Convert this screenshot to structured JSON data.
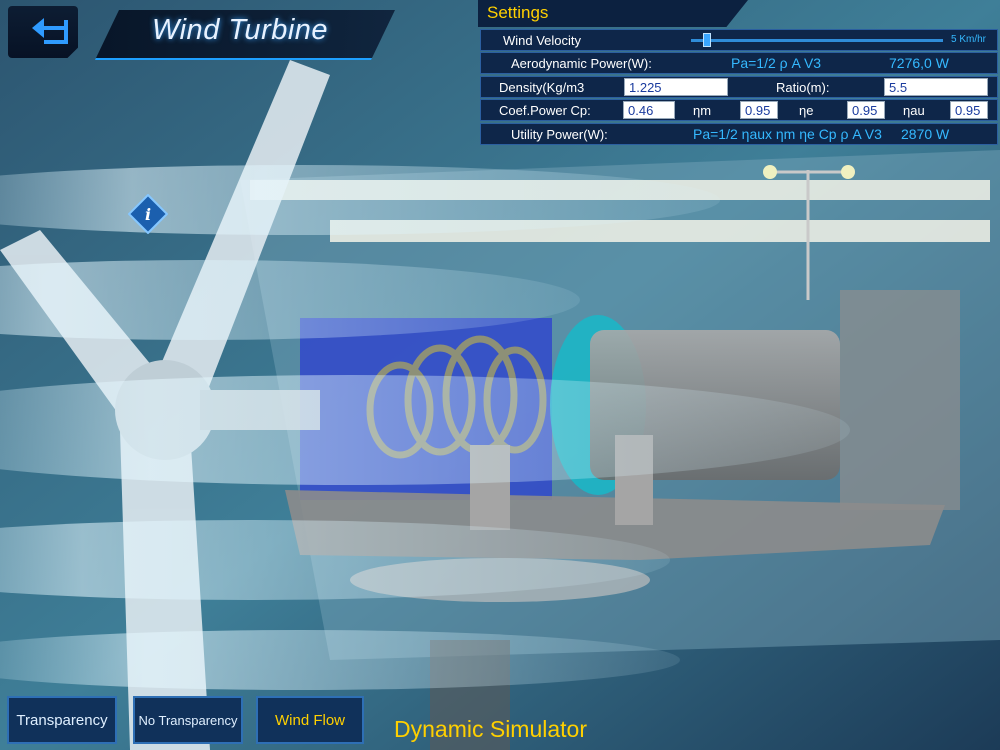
{
  "header": {
    "title": "Wind Turbine"
  },
  "settings": {
    "title": "Settings",
    "wind_velocity": {
      "label": "Wind Velocity",
      "value": "5 Km/hr",
      "slider_fraction": 0.05
    },
    "aero_power": {
      "label": "Aerodynamic Power(W):",
      "formula": "Pa=1/2 ρ A V3",
      "value": "7276,0 W"
    },
    "density": {
      "label": "Density(Kg/m3",
      "value": "1.225"
    },
    "ratio": {
      "label": "Ratio(m):",
      "value": "5.5"
    },
    "coef": {
      "label": "Coef.Power Cp:",
      "cp": "0.46",
      "nm_label": "ηm",
      "nm": "0.95",
      "ne_label": "ηe",
      "ne": "0.95",
      "nau_label": "ηau",
      "nau": "0.95"
    },
    "utility_power": {
      "label": "Utility Power(W):",
      "formula": "Pa=1/2 ηaux ηm ηe Cp ρ A V3",
      "value": "2870 W"
    }
  },
  "buttons": {
    "transparency": "Transparency",
    "no_transparency": "No Transparency",
    "wind_flow": "Wind Flow"
  },
  "footer": {
    "label": "Dynamic Simulator"
  },
  "colors": {
    "accent": "#ffd000",
    "cyan": "#35b9ff",
    "panel": "#0e2649"
  },
  "icons": [
    "back-arrow-icon",
    "info-icon"
  ]
}
